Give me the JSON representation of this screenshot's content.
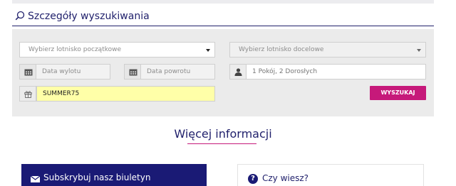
{
  "header": {
    "title": "Szczegóły wyszukiwania"
  },
  "form": {
    "origin_placeholder": "Wybierz lotnisko początkowe",
    "destination_placeholder": "Wybierz lotnisko docelowe",
    "departure_placeholder": "Data wylotu",
    "return_placeholder": "Data powrotu",
    "passengers_value": "1 Pokój, 2 Dorosłych",
    "promo_value": "SUMMER75",
    "search_label": "WYSZUKAJ"
  },
  "sections": {
    "more_info": "Więcej informacji",
    "newsletter": "Subskrybuj nasz biuletyn",
    "did_you_know": "Czy wiesz?"
  },
  "colors": {
    "brand_navy": "#1a1a75",
    "accent_magenta": "#c6197a",
    "promo_highlight": "#ffffa8"
  },
  "icons": [
    "search-icon",
    "calendar-icon",
    "person-icon",
    "gift-icon",
    "envelope-icon",
    "question-icon",
    "chevron-down-icon"
  ]
}
